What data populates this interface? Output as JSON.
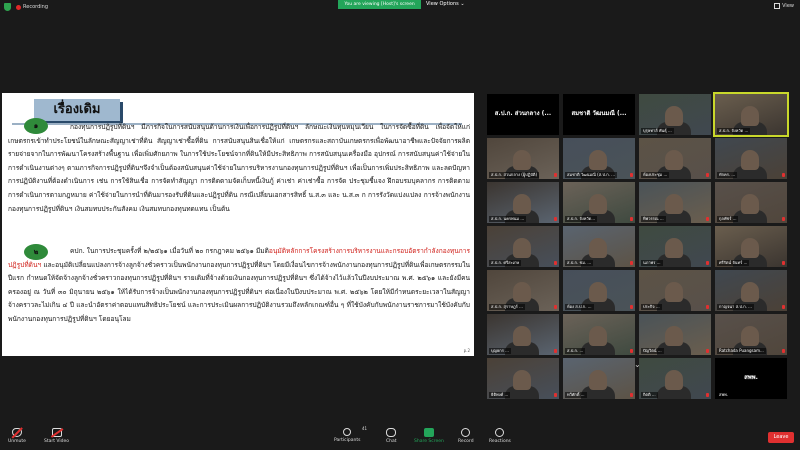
{
  "topbar": {
    "recording_label": "Recording",
    "viewing_banner": "You are viewing [Host]'s screen",
    "view_options_label": "View Options ⌄",
    "view_label": "View"
  },
  "document": {
    "title": "เรื่องเดิม",
    "badge_1": "๑",
    "badge_2": "๒",
    "para1": "กองทุนการปฏิรูปที่ดินฯ มีภารกิจในการสนับสนุนด้านการเงินเพื่อการปฏิรูปที่ดินฯ ลักษณะเงินทุนหมุนเวียน ในการจัดซื้อที่ดิน เพื่อจัดให้แก่เกษตรกรเข้าทำประโยชน์ในลักษณะสัญญาเช่าที่ดิน สัญญาเช่าซื้อที่ดิน การสนับสนุนสินเชื่อให้แก่ เกษตรกรและสถาบันเกษตรกรเพื่อพัฒนาอาชีพและปัจจัยการผลิต รายจ่ายจากในการพัฒนาโครงสร้างพื้นฐาน เพื่อเพิ่มศักยภาพ ในการใช้ประโยชน์จากที่ดินให้มีประสิทธิภาพ การสนับสนุนเครื่องมือ อุปกรณ์ การสนับสนุนค่าใช้จ่ายในการดำเนินงานต่างๆ ตามภารกิจการปฏิรูปที่ดินฯจึงจำเป็นต้องสนับสนุนค่าใช้จ่ายในการบริหารงานกองทุนการปฏิรูปที่ดินฯ เพื่อเป็นการเพิ่มประสิทธิภาพ และลดปัญหาการปฏิบัติงานที่ต้องดำเนินการ เช่น การใช้สินเชื่อ การจัดทำสัญญา การติดตามจัดเก็บหนี้เงินกู้ ค่าเช่า ค่าเช่าซื้อ การจัด ประชุมชี้แจง ฝึกอบรมบุคลากร การติดตามการดำเนินการตามกฎหมาย ค่าใช้จ่ายในการนำที่ดินมารองรับที่ดินและปฏิรูปที่ดิน กรณีเปลี่ยนเอกสารสิทธิ์ น.ส.๓ และ น.ส.๓ ก การรังวัดแบ่งแปลง การจ้างพนักงานกองทุนการปฏิรูปที่ดินฯ เงินสมทบประกันสังคม เงินสมทบกองทุนทดแทน เป็นต้น",
    "para2_a": "คปก. ในการประชุมครั้งที่ ๒/๒๕๖๑ เมื่อวันที่ ๒๐ กรกฎาคม ๒๕๖๑ มีมติ",
    "para2_red1": "อนุมัติหลักการโครงสร้างการบริหารงานและกรอบอัตรากำลังกองทุนการปฏิรูปที่ดินฯ",
    "para2_b": " และอนุมัติเปลี่ยนแปลงการจ้างลูกจ้างชั่วคราวเป็นพนักงานกองทุนการปฏิรูปที่ดินฯ โดยมีเงื่อนไขการจ้างพนักงานกองทุนการปฏิรูปที่ดินเพื่อเกษตรกรรมในปีแรก กำหนดให้จัดจ้างลูกจ้างชั่วคราวกองทุนการปฏิรูปที่ดินฯ รายเดิมที่จ้างด้วยเงินกองทุนการปฏิรูปที่ดินฯ ซึ่งได้จ้างไว้แล้วในปีงบประมาณ พ.ศ. ๒๕๖๑ และยังมีคนครองอยู่ ณ วันที่ ๓๐ มิถุนายน ๒๕๖๑ ให้ได้รับการจ้างเป็นพนักงานกองทุนการปฏิรูปที่ดินฯ ต่อเนื่องในปีงบประมาณ พ.ศ. ๒๕๖๒ โดยให้มีกำหนดระยะเวลาในสัญญาจ้างคราวละไม่เกิน ๔ ปี และนำอัตราค่าตอบแทนสิทธิประโยชน์ และการประเมินผลการปฏิบัติงานรวมถึงหลักเกณฑ์อื่น ๆ ที่ใช้บังคับกับพนักงานราชการมาใช้บังคับกับพนักงานกองทุนการปฏิรูปที่ดินฯ โดยอนุโลม",
    "corner": "p.2"
  },
  "participants": [
    {
      "label": "ส.ป.ก. ส่วนกลาง (...",
      "type": "name-only",
      "muted": false
    },
    {
      "label": "สมชาติ วัฒนมณี (...",
      "type": "name-only",
      "muted": false
    },
    {
      "label": "บุรุษทาส์ พันธุ์ ...",
      "type": "video",
      "muted": false
    },
    {
      "label": "ส.ป.ก. จังหวัด ...",
      "type": "video",
      "muted": false,
      "active": true
    },
    {
      "label": "ส.ป.ก. สวนกลาง (ผู้ปฏิบัติ)",
      "type": "video",
      "muted": true
    },
    {
      "label": "สมชาติ วัฒนมณี (ส.ป.ก. ...",
      "type": "video",
      "muted": true
    },
    {
      "label": "ห้องประชุม ...",
      "type": "video",
      "muted": true
    },
    {
      "label": "ทักคร. ...",
      "type": "video",
      "muted": true
    },
    {
      "label": "ส.ป.ก. นครพนม ...",
      "type": "video",
      "muted": true
    },
    {
      "label": "ส.ป.ก. จังหวัด...",
      "type": "video",
      "muted": true
    },
    {
      "label": "ทิพวรรณ ...",
      "type": "video",
      "muted": true
    },
    {
      "label": "กุลพัชร์ ...",
      "type": "video",
      "muted": true
    },
    {
      "label": "ส.ป.ก. ศรีสะเกษ",
      "type": "video",
      "muted": true
    },
    {
      "label": "ส.ป.ก. ชม. ...",
      "type": "video",
      "muted": true
    },
    {
      "label": "นภาพร ...",
      "type": "video",
      "muted": true
    },
    {
      "label": "ศรีรัตน์ จันทร์ ...",
      "type": "video",
      "muted": true
    },
    {
      "label": "ส.ป.ก. สุราษฎร์ ...",
      "type": "video",
      "muted": true
    },
    {
      "label": "ห้อง ส.ป.ก. ...",
      "type": "video",
      "muted": true
    },
    {
      "label": "ประกิจ ...",
      "type": "video",
      "muted": true
    },
    {
      "label": "กาญจนา ส.ป.ก. ...",
      "type": "video",
      "muted": true
    },
    {
      "label": "บุญยกร ...",
      "type": "video",
      "muted": true
    },
    {
      "label": "ส.ป.ก. ...",
      "type": "video",
      "muted": true
    },
    {
      "label": "ปัญวิตน์ ...",
      "type": "video",
      "muted": true
    },
    {
      "label": "Ratchada Puangsam...",
      "type": "video",
      "muted": true
    },
    {
      "label": "ธิติพงศ์ ...",
      "type": "video",
      "muted": true
    },
    {
      "label": "ทวีศักดิ์ ...",
      "type": "video",
      "muted": true
    },
    {
      "label": "กิตติ ...",
      "type": "video",
      "muted": true
    },
    {
      "label": "สพพ.",
      "type": "name-only",
      "muted": false,
      "sub": "สพพ."
    }
  ],
  "toolbar": {
    "unmute": "Unmute",
    "start_video": "Start Video",
    "participants": "Participants",
    "participants_count": "41",
    "chat": "Chat",
    "share_screen": "Share Screen",
    "record": "Record",
    "reactions": "Reactions",
    "leave": "Leave"
  },
  "colors": {
    "accent_green": "#23a55a",
    "leave_red": "#e03030",
    "active_speaker": "#c9d82b"
  }
}
